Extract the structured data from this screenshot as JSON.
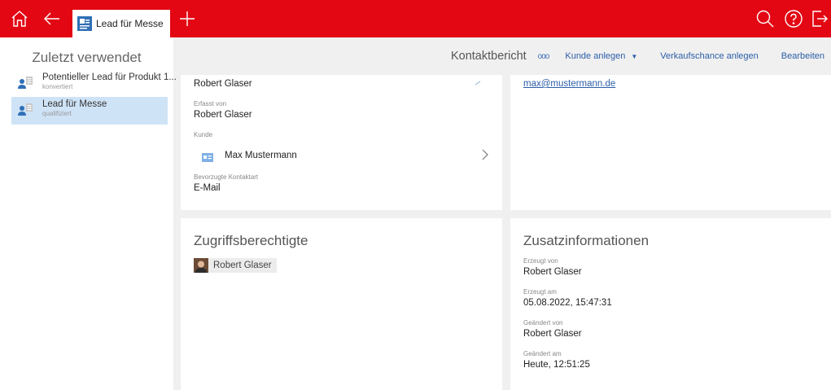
{
  "topbar": {
    "tab_label": "Lead für Messe",
    "icons": [
      "home-icon",
      "back-icon",
      "plus-icon",
      "search-icon",
      "help-icon",
      "logout-icon"
    ],
    "accent_color": "#e30613"
  },
  "sidebar": {
    "title": "Zuletzt verwendet",
    "items": [
      {
        "title": "Potentieller Lead für Produkt 1...",
        "status": "konvertiert",
        "active": false
      },
      {
        "title": "Lead für Messe",
        "status": "qualifiziert",
        "active": true
      }
    ]
  },
  "header": {
    "title": "Kontaktbericht",
    "dots": "ooo",
    "actions": {
      "kunde_anlegen": "Kunde anlegen",
      "verkaufschance": "Verkaufschance anlegen",
      "bearbeiten": "Bearbeiten"
    }
  },
  "details": {
    "top_value": "Robert Glaser",
    "erfasst_von_label": "Erfasst von",
    "erfasst_von": "Robert Glaser",
    "kunde_label": "Kunde",
    "kunde": "Max Mustermann",
    "kontaktart_label": "Bevorzugte Kontaktart",
    "kontaktart": "E-Mail"
  },
  "contact": {
    "email": "max@mustermann.de"
  },
  "access": {
    "title": "Zugriffsberechtigte",
    "person": "Robert Glaser"
  },
  "extra": {
    "title": "Zusatzinformationen",
    "erzeugt_von_label": "Erzeugt von",
    "erzeugt_von": "Robert Glaser",
    "erzeugt_am_label": "Erzeugt am",
    "erzeugt_am": "05.08.2022, 15:47:31",
    "geaendert_von_label": "Geändert von",
    "geaendert_von": "Robert Glaser",
    "geaendert_am_label": "Geändert am",
    "geaendert_am": "Heute, 12:51:25"
  }
}
